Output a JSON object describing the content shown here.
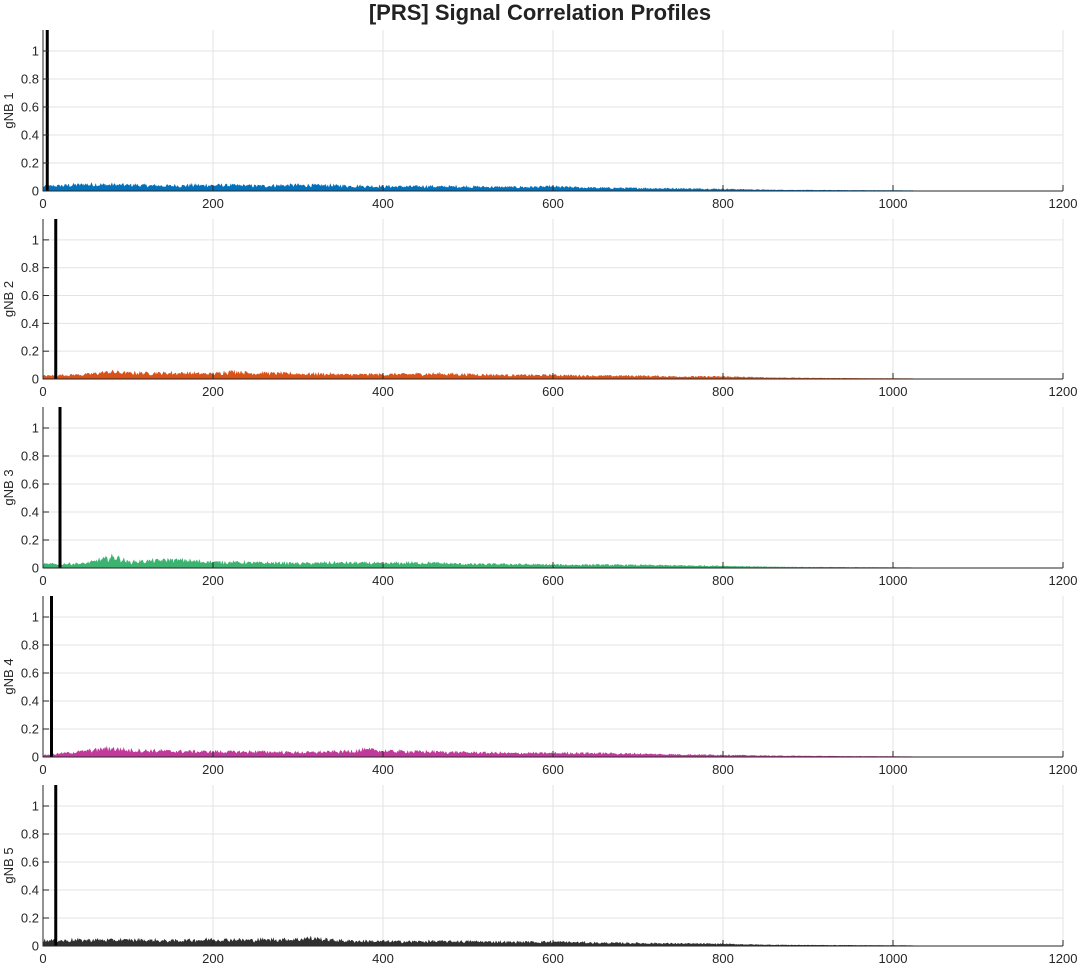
{
  "title": "[PRS] Signal Correlation Profiles",
  "chart_data": [
    {
      "type": "line",
      "ylabel": "gNB 1",
      "color": "#0072BD",
      "xlim": [
        0,
        1200
      ],
      "ylim": [
        0,
        1.15
      ],
      "xticks": [
        0,
        200,
        400,
        600,
        800,
        1000,
        1200
      ],
      "yticks": [
        0,
        0.2,
        0.4,
        0.6,
        0.8,
        1
      ],
      "grid": true,
      "peak": {
        "x": 5,
        "y": 1.15
      },
      "series": [
        {
          "x": [
            0,
            50,
            100,
            150,
            200,
            250,
            300,
            350,
            400,
            450,
            500,
            550,
            600,
            650,
            700,
            750,
            800,
            850,
            900,
            950,
            1000,
            1023
          ],
          "y": [
            0.03,
            0.045,
            0.04,
            0.035,
            0.04,
            0.035,
            0.04,
            0.035,
            0.03,
            0.03,
            0.028,
            0.025,
            0.028,
            0.02,
            0.018,
            0.015,
            0.012,
            0.006,
            0.004,
            0.003,
            0.002,
            0.001
          ]
        }
      ]
    },
    {
      "type": "line",
      "ylabel": "gNB 2",
      "color": "#D95319",
      "xlim": [
        0,
        1200
      ],
      "ylim": [
        0,
        1.15
      ],
      "xticks": [
        0,
        200,
        400,
        600,
        800,
        1000,
        1200
      ],
      "yticks": [
        0,
        0.2,
        0.4,
        0.6,
        0.8,
        1
      ],
      "grid": true,
      "peak": {
        "x": 15,
        "y": 1.15
      },
      "series": [
        {
          "x": [
            0,
            50,
            80,
            100,
            150,
            200,
            220,
            250,
            300,
            350,
            400,
            450,
            500,
            550,
            600,
            650,
            700,
            750,
            800,
            850,
            900,
            950,
            1000,
            1023
          ],
          "y": [
            0.02,
            0.03,
            0.05,
            0.04,
            0.04,
            0.035,
            0.05,
            0.04,
            0.035,
            0.03,
            0.03,
            0.035,
            0.03,
            0.025,
            0.025,
            0.02,
            0.02,
            0.015,
            0.015,
            0.008,
            0.005,
            0.003,
            0.002,
            0.001
          ]
        }
      ]
    },
    {
      "type": "line",
      "ylabel": "gNB 3",
      "color": "#3CB371",
      "xlim": [
        0,
        1200
      ],
      "ylim": [
        0,
        1.15
      ],
      "xticks": [
        0,
        200,
        400,
        600,
        800,
        1000,
        1200
      ],
      "yticks": [
        0,
        0.2,
        0.4,
        0.6,
        0.8,
        1
      ],
      "grid": true,
      "peak": {
        "x": 20,
        "y": 1.15
      },
      "series": [
        {
          "x": [
            0,
            50,
            85,
            100,
            150,
            200,
            250,
            300,
            350,
            400,
            450,
            500,
            550,
            600,
            650,
            700,
            750,
            800,
            850,
            900,
            950,
            1000,
            1023
          ],
          "y": [
            0.025,
            0.03,
            0.08,
            0.04,
            0.055,
            0.04,
            0.035,
            0.03,
            0.035,
            0.03,
            0.035,
            0.025,
            0.025,
            0.02,
            0.02,
            0.018,
            0.015,
            0.012,
            0.006,
            0.004,
            0.003,
            0.002,
            0.001
          ]
        }
      ]
    },
    {
      "type": "line",
      "ylabel": "gNB 4",
      "color": "#C13A9B",
      "xlim": [
        0,
        1200
      ],
      "ylim": [
        0,
        1.15
      ],
      "xticks": [
        0,
        200,
        400,
        600,
        800,
        1000,
        1200
      ],
      "yticks": [
        0,
        0.2,
        0.4,
        0.6,
        0.8,
        1
      ],
      "grid": true,
      "peak": {
        "x": 10,
        "y": 1.15
      },
      "series": [
        {
          "x": [
            0,
            50,
            80,
            100,
            150,
            200,
            250,
            300,
            350,
            390,
            400,
            450,
            500,
            550,
            600,
            650,
            700,
            750,
            800,
            850,
            900,
            950,
            1000,
            1023
          ],
          "y": [
            0.01,
            0.04,
            0.06,
            0.045,
            0.04,
            0.035,
            0.035,
            0.03,
            0.035,
            0.05,
            0.04,
            0.035,
            0.03,
            0.025,
            0.025,
            0.025,
            0.02,
            0.015,
            0.012,
            0.007,
            0.005,
            0.003,
            0.002,
            0.001
          ]
        }
      ]
    },
    {
      "type": "line",
      "ylabel": "gNB 5",
      "color": "#303030",
      "xlim": [
        0,
        1200
      ],
      "ylim": [
        0,
        1.15
      ],
      "xticks": [
        0,
        200,
        400,
        600,
        800,
        1000,
        1200
      ],
      "yticks": [
        0,
        0.2,
        0.4,
        0.6,
        0.8,
        1
      ],
      "grid": true,
      "peak": {
        "x": 15,
        "y": 1.15
      },
      "series": [
        {
          "x": [
            0,
            50,
            100,
            150,
            200,
            250,
            300,
            310,
            350,
            400,
            450,
            500,
            550,
            600,
            650,
            700,
            750,
            800,
            850,
            900,
            950,
            1000,
            1023
          ],
          "y": [
            0.035,
            0.04,
            0.04,
            0.035,
            0.045,
            0.04,
            0.045,
            0.055,
            0.035,
            0.03,
            0.03,
            0.03,
            0.025,
            0.028,
            0.02,
            0.018,
            0.015,
            0.012,
            0.006,
            0.004,
            0.003,
            0.002,
            0.001
          ]
        }
      ]
    }
  ]
}
